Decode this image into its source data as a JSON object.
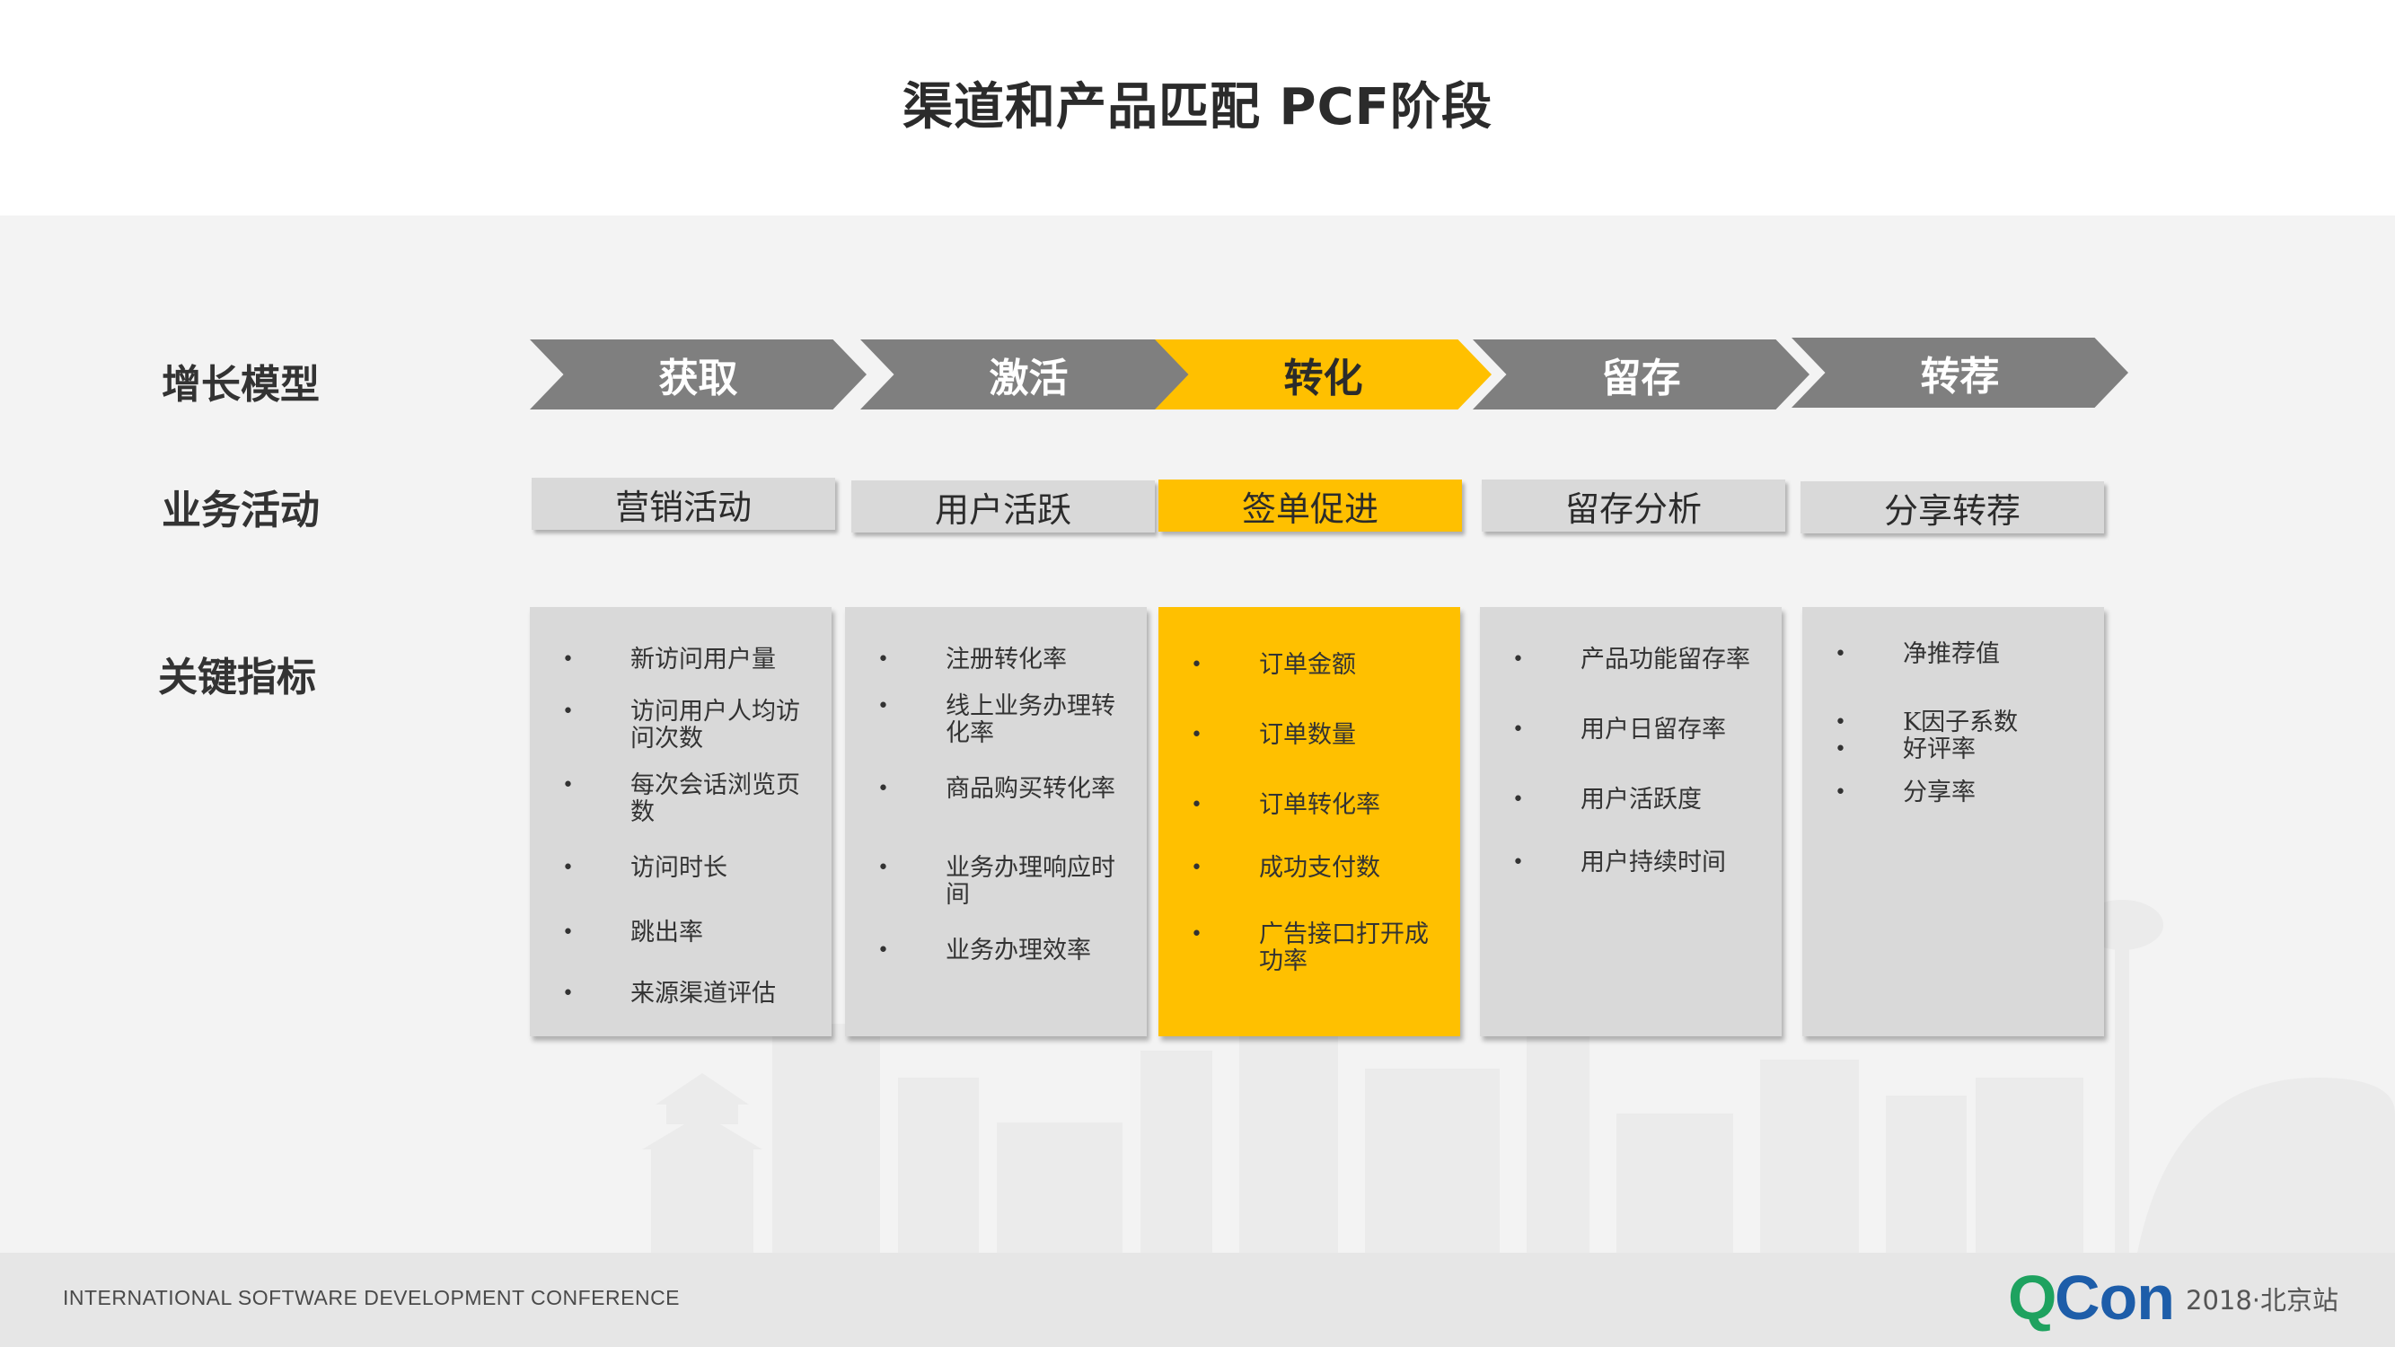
{
  "title": "渠道和产品匹配 PCF阶段",
  "row_labels": {
    "growth_model": "增长模型",
    "business_activity": "业务活动",
    "key_metrics": "关键指标"
  },
  "stages": [
    {
      "label": "获取",
      "highlight": false
    },
    {
      "label": "激活",
      "highlight": false
    },
    {
      "label": "转化",
      "highlight": true
    },
    {
      "label": "留存",
      "highlight": false
    },
    {
      "label": "转荐",
      "highlight": false
    }
  ],
  "activities": [
    {
      "label": "营销活动",
      "highlight": false
    },
    {
      "label": "用户活跃",
      "highlight": false
    },
    {
      "label": "签单促进",
      "highlight": true
    },
    {
      "label": "留存分析",
      "highlight": false
    },
    {
      "label": "分享转荐",
      "highlight": false
    }
  ],
  "metrics": [
    {
      "highlight": false,
      "items": [
        "新访问用户量",
        "访问用户人均访问次数",
        "每次会话浏览页数",
        "访问时长",
        "跳出率",
        "来源渠道评估"
      ]
    },
    {
      "highlight": false,
      "items": [
        "注册转化率",
        "线上业务办理转化率",
        "商品购买转化率",
        "业务办理响应时间",
        "业务办理效率"
      ]
    },
    {
      "highlight": true,
      "items": [
        "订单金额",
        "订单数量",
        "订单转化率",
        "成功支付数",
        "广告接口打开成功率"
      ]
    },
    {
      "highlight": false,
      "items": [
        "产品功能留存率",
        "用户日留存率",
        "用户活跃度",
        "用户持续时间"
      ]
    },
    {
      "highlight": false,
      "items": [
        "净推荐值",
        "K因子系数",
        "好评率",
        "分享率"
      ]
    }
  ],
  "colors": {
    "accent": "#ffc000",
    "chevron_gray": "#7f7f7f",
    "card_gray": "#d9d9d9"
  },
  "footer": {
    "conference": "INTERNATIONAL SOFTWARE DEVELOPMENT CONFERENCE",
    "logo_q": "Q",
    "logo_con": "Con",
    "year_city": "2018·北京站"
  }
}
